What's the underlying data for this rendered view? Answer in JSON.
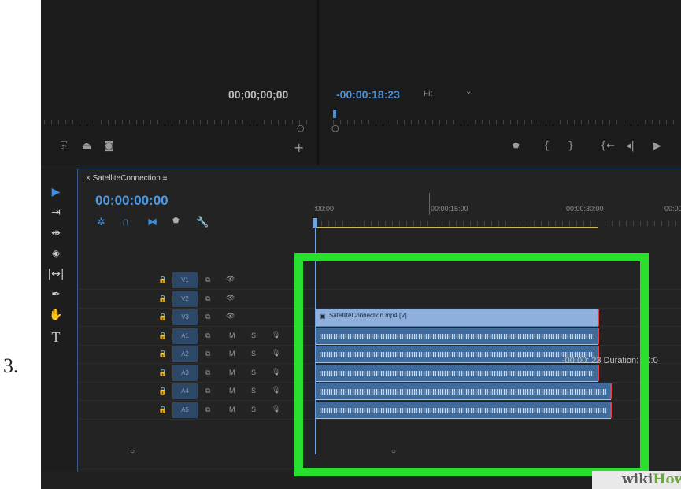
{
  "step_label": "3.",
  "source_monitor": {
    "timecode": "00;00;00;00"
  },
  "program_monitor": {
    "timecode": "-00:00:18:23",
    "zoom": "Fit"
  },
  "program_controls": [
    "marker-icon",
    "in-point-icon",
    "out-point-icon",
    "go-to-in-icon",
    "step-back-icon",
    "play-icon"
  ],
  "timeline": {
    "sequence_name": "SatelliteConnection",
    "timecode": "00:00:00:00",
    "ruler": [
      ":00:00",
      "00:00:15:00",
      "00:00:30:00",
      "00:00"
    ],
    "tracks": [
      {
        "name": "V1",
        "type": "video"
      },
      {
        "name": "V2",
        "type": "video"
      },
      {
        "name": "V3",
        "type": "video"
      },
      {
        "name": "A1",
        "type": "audio"
      },
      {
        "name": "A2",
        "type": "audio"
      },
      {
        "name": "A3",
        "type": "audio"
      },
      {
        "name": "A4",
        "type": "audio"
      },
      {
        "name": "A5",
        "type": "audio"
      }
    ],
    "audio_buttons": {
      "mute": "M",
      "solo": "S"
    },
    "clip_label": "SatelliteConnection.mp4 [V]",
    "tooltip": "-00:00:  23 Duration: 00:0"
  },
  "tools": [
    "selection-tool",
    "track-select-tool",
    "ripple-edit-tool",
    "razor-tool",
    "slip-tool",
    "pen-tool",
    "hand-tool",
    "type-tool"
  ],
  "tool_text": "T",
  "watermark": {
    "wiki": "wiki",
    "how": "How"
  },
  "colors": {
    "highlight": "#28e02c",
    "timecode_blue": "#4a90d9",
    "clip": "#8fb0dc"
  }
}
